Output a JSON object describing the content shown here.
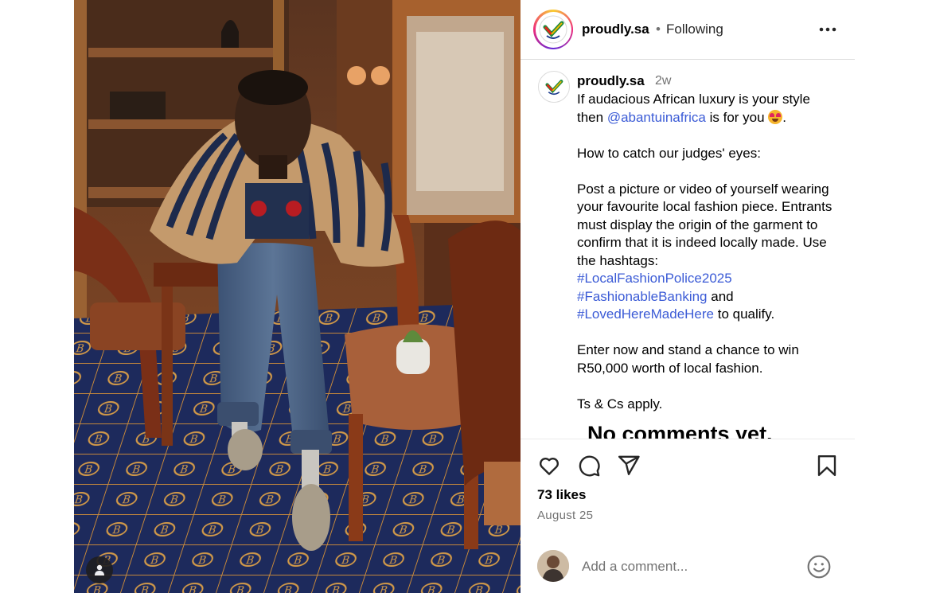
{
  "post": {
    "author": "proudly.sa",
    "separator": "•",
    "follow_status": "Following",
    "caption_time": "2w",
    "caption_line1": "If audacious African luxury is your style then ",
    "mention": "@abantuinafrica",
    "caption_line1_end": " is for you ",
    "caption_line1_tail": ".",
    "caption_p2": "How to catch our judges' eyes:",
    "caption_p3": "Post a picture or video of yourself wearing your favourite local fashion piece. Entrants must display the origin of the garment to confirm that it is indeed locally made. Use the hashtags:",
    "hashtag1": "#LocalFashionPolice2025",
    "hashtag2": "#FashionableBanking",
    "and_word": " and",
    "hashtag3": "#LovedHereMadeHere",
    "qualify": " to qualify.",
    "caption_p4": "Enter now and stand a chance to win R50,000 worth of local fashion.",
    "caption_p5": "Ts & Cs apply.",
    "no_comments": "No comments yet.",
    "likes": "73 likes",
    "date": "August 25",
    "comment_placeholder": "Add a comment..."
  },
  "icons": {
    "more": "more-options-icon",
    "like": "heart-icon",
    "comment": "comment-icon",
    "share": "share-icon",
    "save": "bookmark-icon",
    "emoji": "smiley-icon",
    "tagged": "person-icon"
  },
  "colors": {
    "link": "#3b5bd6",
    "muted": "#737373",
    "divider": "#dbdbdb"
  }
}
